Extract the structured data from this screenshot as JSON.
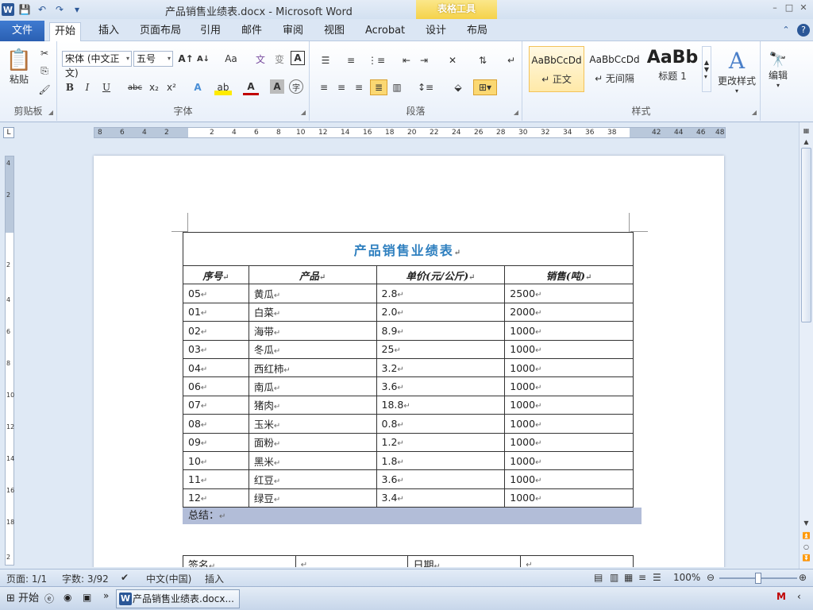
{
  "titlebar": {
    "title": "产品销售业绩表.docx - Microsoft Word",
    "context_tools": "表格工具",
    "app_icon": "W",
    "window_controls": [
      "–",
      "□",
      "✕"
    ]
  },
  "tabs": {
    "file": "文件",
    "items": [
      "开始",
      "插入",
      "页面布局",
      "引用",
      "邮件",
      "审阅",
      "视图",
      "Acrobat",
      "设计",
      "布局"
    ]
  },
  "ribbon": {
    "clipboard": {
      "label": "剪贴板",
      "paste": "粘贴"
    },
    "font": {
      "label": "字体",
      "font_name": "宋体 (中文正文)",
      "font_size": "五号",
      "grow": "A↑",
      "shrink": "A↓",
      "case": "Aa",
      "bold": "B",
      "italic": "I",
      "underline": "U",
      "strike": "abc",
      "subscript": "x₂",
      "superscript": "x²"
    },
    "paragraph": {
      "label": "段落"
    },
    "styles": {
      "label": "样式",
      "items": [
        {
          "sample": "AaBbCcDd",
          "name": "↵ 正文"
        },
        {
          "sample": "AaBbCcDd",
          "name": "↵ 无间隔"
        },
        {
          "sample": "AaBb",
          "name": "标题 1"
        }
      ],
      "change": "更改样式"
    },
    "editing": {
      "label": "编辑"
    }
  },
  "ruler": {
    "numbers": [
      "8",
      "6",
      "4",
      "2",
      "",
      "2",
      "4",
      "6",
      "8",
      "10",
      "12",
      "14",
      "16",
      "18",
      "20",
      "22",
      "24",
      "26",
      "28",
      "30",
      "32",
      "34",
      "36",
      "38",
      "",
      "42",
      "44",
      "46",
      "48"
    ],
    "vnumbers": [
      "4",
      "2",
      "",
      "2",
      "4",
      "6",
      "8",
      "10",
      "12",
      "14",
      "16",
      "18",
      "2"
    ]
  },
  "table": {
    "title": "产品销售业绩表",
    "headers": [
      "序号",
      "产品",
      "单价(元/公斤)",
      "销售(吨)"
    ],
    "rows": [
      [
        "05",
        "黄瓜",
        "2.8",
        "2500"
      ],
      [
        "01",
        "白菜",
        "2.0",
        "2000"
      ],
      [
        "02",
        "海带",
        "8.9",
        "1000"
      ],
      [
        "03",
        "冬瓜",
        "25",
        "1000"
      ],
      [
        "04",
        "西红柿",
        "3.2",
        "1000"
      ],
      [
        "06",
        "南瓜",
        "3.6",
        "1000"
      ],
      [
        "07",
        "猪肉",
        "18.8",
        "1000"
      ],
      [
        "08",
        "玉米",
        "0.8",
        "1000"
      ],
      [
        "09",
        "面粉",
        "1.2",
        "1000"
      ],
      [
        "10",
        "黑米",
        "1.8",
        "1000"
      ],
      [
        "11",
        "红豆",
        "3.6",
        "1000"
      ],
      [
        "12",
        "绿豆",
        "3.4",
        "1000"
      ]
    ],
    "summary": "总结：",
    "sign": "签名",
    "date": "日期",
    "cell_mark": "↵"
  },
  "status": {
    "page": "页面: 1/1",
    "words": "字数: 3/92",
    "language": "中文(中国)",
    "mode": "插入",
    "zoom": "100%"
  },
  "taskbar": {
    "start": "开始",
    "task": "产品销售业绩表.docx..."
  },
  "colors": {
    "title_blue": "#2e7fbf",
    "file_tab": "#2a5fb2",
    "context_tools": "#f5d24a",
    "summary_highlight": "#b2bdd8"
  }
}
